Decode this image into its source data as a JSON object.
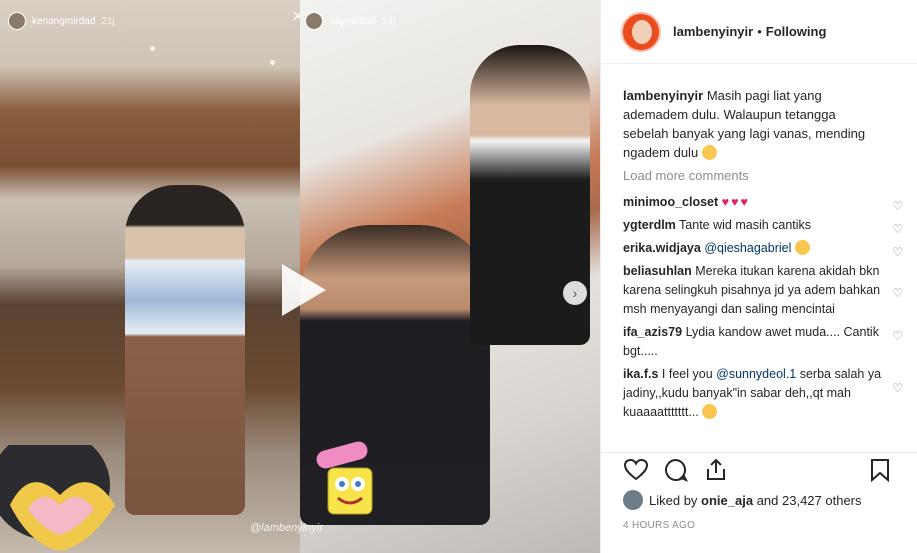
{
  "post": {
    "username": "lambenyinyir",
    "separator": "•",
    "follow_status": "Following",
    "caption_user": "lambenyinyir",
    "caption_text": "Masih pagi liat yang ademadem dulu. Walaupun tetangga sebelah banyak yang lagi vanas, mending ngadem dulu",
    "load_more": "Load more comments",
    "likes_user": "onie_aja",
    "likes_prefix": "Liked by",
    "likes_suffix": "and 23,427 others",
    "time_ago": "4 HOURS AGO"
  },
  "media": {
    "left_story_user": "kenangmirdad",
    "left_story_time": "21j",
    "right_story_user": "naymirdad",
    "right_story_time": "19j",
    "watermark": "@lambenyinyir"
  },
  "comments": [
    {
      "user": "minimoo_closet",
      "text": "",
      "emoji": "three-red-hearts"
    },
    {
      "user": "ygterdlm",
      "text": "Tante wid masih cantiks"
    },
    {
      "user": "erika.widjaya",
      "mention": "@qieshagabriel",
      "text": "",
      "emoji": "laughing-tears"
    },
    {
      "user": "beliasuhlan",
      "text": "Mereka itukan karena akidah bkn karena selingkuh pisahnya jd ya adem bahkan msh menyayangi dan saling mencintai"
    },
    {
      "user": "ifa_azis79",
      "text": "Lydia kandow awet muda.... Cantik bgt....."
    },
    {
      "user": "ika.f.s",
      "text": "I feel you",
      "mention": "@sunnydeol.1",
      "text2": "serba salah ya jadiny,,kudu banyak\"in sabar deh,,qt mah kuaaaattttttt...",
      "emoji": "sunglasses-face"
    }
  ],
  "icons": {
    "like": "heart-outline-icon",
    "comment": "comment-bubble-icon",
    "share": "share-arrow-icon",
    "save": "bookmark-icon",
    "play": "play-icon",
    "next": "chevron-right-icon",
    "comment_like": "small-heart-icon"
  },
  "colors": {
    "accent_red": "#ed4956",
    "mention_blue": "#00376b",
    "muted_gray": "#8e8e8e"
  }
}
